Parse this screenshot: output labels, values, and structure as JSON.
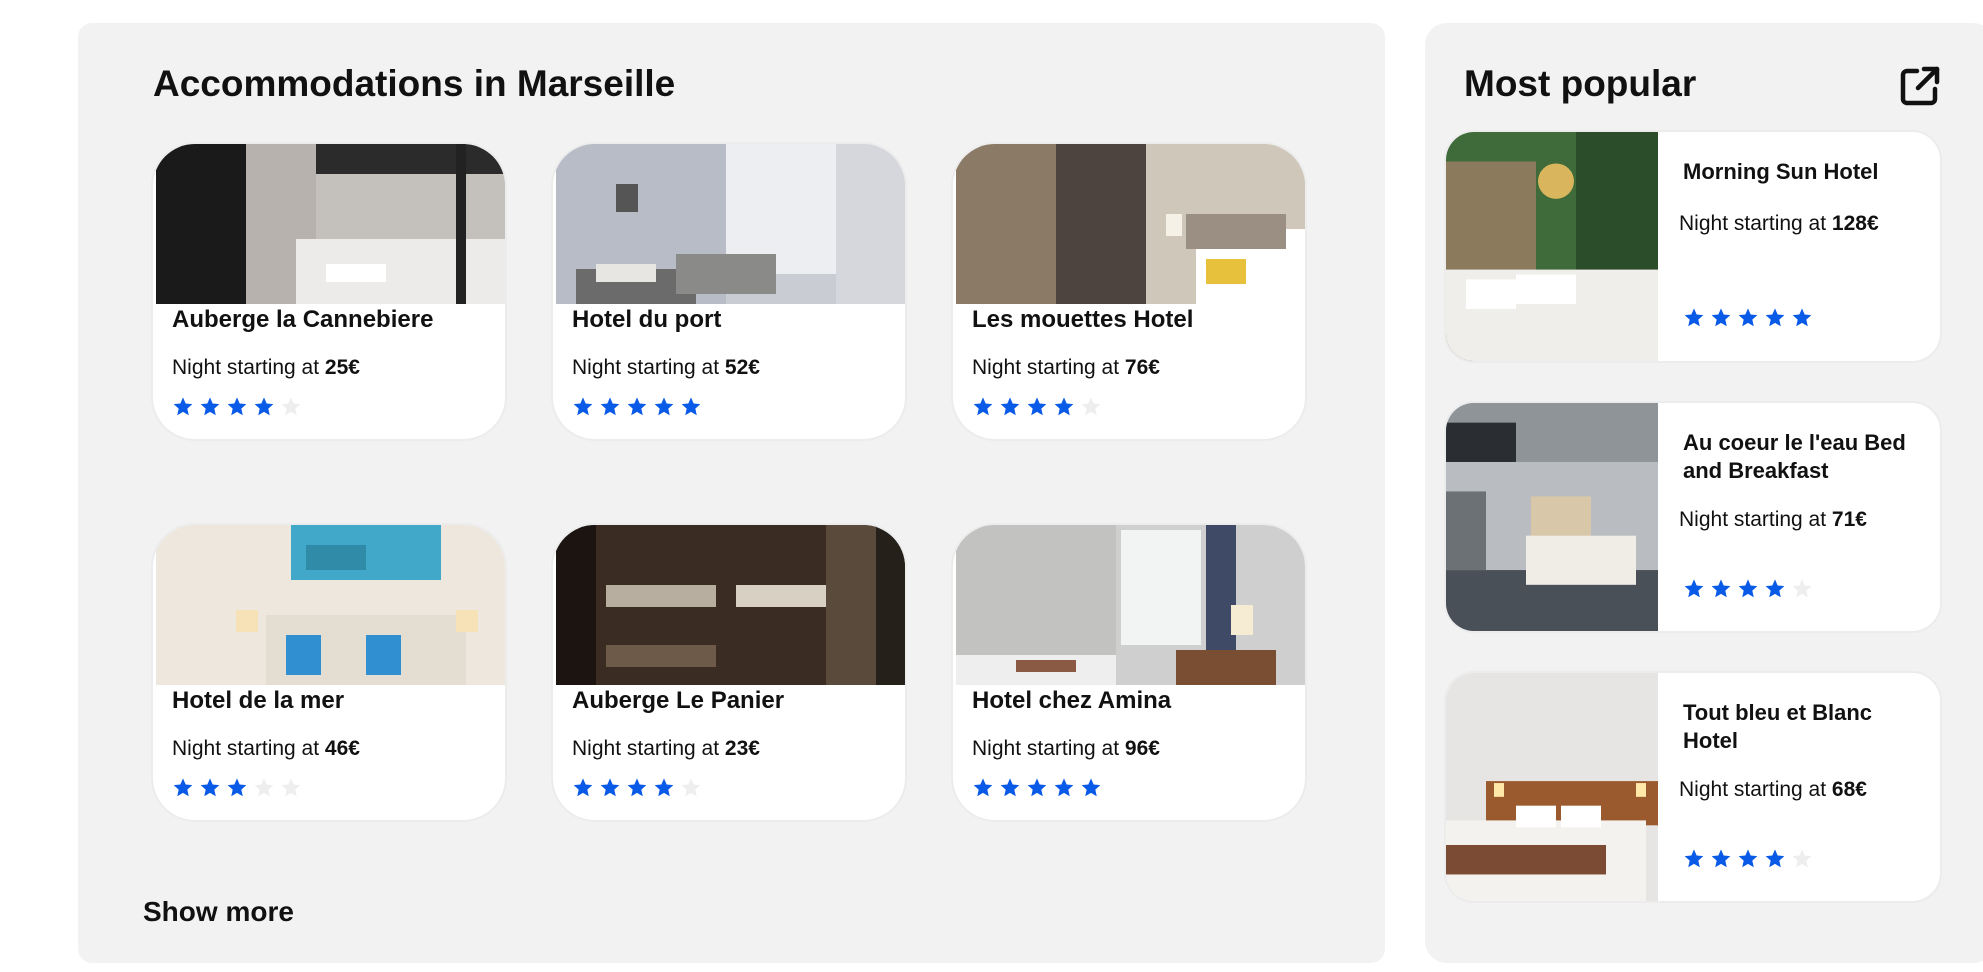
{
  "main": {
    "title": "Accommodations in Marseille",
    "show_more_label": "Show more",
    "price_prefix": "Night starting at ",
    "cards": [
      {
        "name": "Auberge la Cannebiere",
        "price": "25€",
        "rating": 4
      },
      {
        "name": "Hotel du port",
        "price": "52€",
        "rating": 5
      },
      {
        "name": "Les mouettes Hotel",
        "price": "76€",
        "rating": 4
      },
      {
        "name": "Hotel de la mer",
        "price": "46€",
        "rating": 3
      },
      {
        "name": "Auberge Le Panier",
        "price": "23€",
        "rating": 4
      },
      {
        "name": "Hotel chez Amina",
        "price": "96€",
        "rating": 5
      }
    ]
  },
  "side": {
    "title": "Most popular",
    "open_icon": "external-link-icon",
    "price_prefix": "Night starting at ",
    "items": [
      {
        "name": "Morning Sun Hotel",
        "price": "128€",
        "rating": 5
      },
      {
        "name": "Au coeur le l'eau Bed and Breakfast",
        "price": "71€",
        "rating": 4
      },
      {
        "name": "Tout bleu et Blanc Hotel",
        "price": "68€",
        "rating": 4
      }
    ]
  },
  "colors": {
    "star_filled": "#0a5ae8",
    "star_empty": "#eeeeee",
    "panel_bg": "#f2f2f2"
  },
  "max_rating": 5
}
